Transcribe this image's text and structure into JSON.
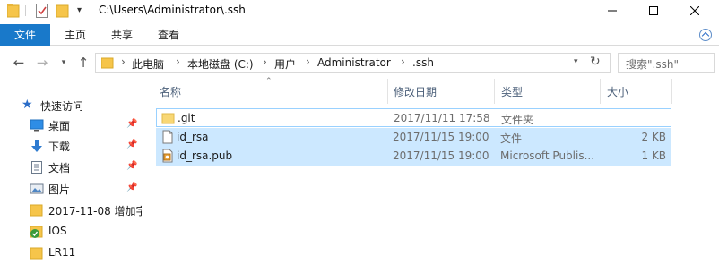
{
  "window": {
    "title": "C:\\Users\\Administrator\\.ssh"
  },
  "ribbon": {
    "tabs": [
      {
        "label": "文件"
      },
      {
        "label": "主页"
      },
      {
        "label": "共享"
      },
      {
        "label": "查看"
      }
    ]
  },
  "address": {
    "crumbs": [
      "此电脑",
      "本地磁盘 (C:)",
      "用户",
      "Administrator",
      ".ssh"
    ]
  },
  "search": {
    "placeholder": "搜索\".ssh\""
  },
  "navpane": {
    "items": [
      {
        "label": "快速访问",
        "icon": "star-icon",
        "pinned": false
      },
      {
        "label": "桌面",
        "icon": "desktop-icon",
        "pinned": true
      },
      {
        "label": "下载",
        "icon": "download-icon",
        "pinned": true
      },
      {
        "label": "文档",
        "icon": "document-icon",
        "pinned": true
      },
      {
        "label": "图片",
        "icon": "picture-icon",
        "pinned": true
      },
      {
        "label": "2017-11-08 增加字",
        "icon": "folder-icon",
        "pinned": false
      },
      {
        "label": "IOS",
        "icon": "sync-folder-icon",
        "pinned": false
      },
      {
        "label": "LR11",
        "icon": "folder-icon",
        "pinned": false
      }
    ]
  },
  "filelist": {
    "columns": [
      "名称",
      "修改日期",
      "类型",
      "大小"
    ],
    "rows": [
      {
        "name": ".git",
        "modified": "2017/11/11 17:58",
        "type": "文件夹",
        "size": "",
        "icon": "folder-icon"
      },
      {
        "name": "id_rsa",
        "modified": "2017/11/15 19:00",
        "type": "文件",
        "size": "2 KB",
        "icon": "file-icon"
      },
      {
        "name": "id_rsa.pub",
        "modified": "2017/11/15 19:00",
        "type": "Microsoft Publis...",
        "size": "1 KB",
        "icon": "publisher-file-icon"
      }
    ]
  },
  "colors": {
    "accent": "#1979ca",
    "selection": "#cce8ff",
    "folder": "#f6c54a"
  }
}
